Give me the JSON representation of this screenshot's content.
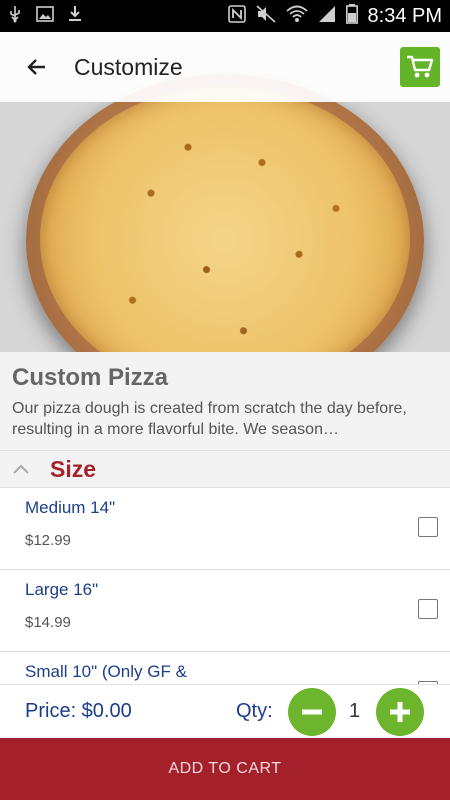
{
  "status_bar": {
    "time": "8:34 PM",
    "icons_left": [
      "usb-icon",
      "image-icon",
      "download-icon"
    ],
    "icons_right": [
      "nfc-icon",
      "mute-icon",
      "wifi-icon",
      "signal-icon",
      "battery-icon"
    ]
  },
  "app_bar": {
    "title": "Customize",
    "accent_color": "#64b42a"
  },
  "item": {
    "name": "Custom Pizza",
    "description": "Our pizza dough is created from scratch the day before, resulting in a more flavorful bite. We season…"
  },
  "size_section": {
    "title": "Size",
    "options": [
      {
        "name": "Medium 14\"",
        "price": "$12.99",
        "checked": false
      },
      {
        "name": "Large 16\"",
        "price": "$14.99",
        "checked": false
      },
      {
        "name": "Small 10\" (Only GF &",
        "price": "",
        "checked": false
      }
    ]
  },
  "order": {
    "price_label": "Price: $0.00",
    "qty_label": "Qty:",
    "qty_value": "1"
  },
  "add_to_cart_label": "ADD TO CART",
  "colors": {
    "brand_red": "#a4212b",
    "link_blue": "#1b3e8a",
    "green": "#6cb52d"
  }
}
